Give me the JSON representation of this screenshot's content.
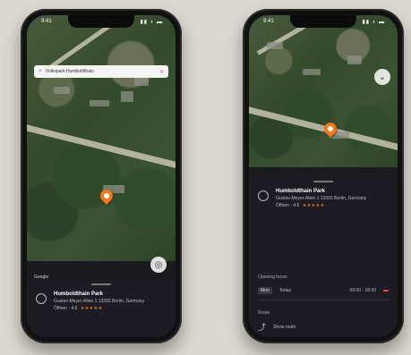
{
  "status": {
    "time": "9:41",
    "icons": "▮▮ ◗ ▬"
  },
  "left_phone": {
    "search_text": "Volkspark Humboldthain",
    "place": {
      "name": "Humboldthain Park",
      "address": "Gustav-Meyer-Allee 1 13355 Berlin, Germany",
      "rating_text": "Öffnen · 4.6",
      "stars": "★★★★★"
    },
    "google_label": "Google"
  },
  "right_phone": {
    "place": {
      "name": "Humboldthain Park",
      "address": "Gustav-Meyer-Allee 1 13355 Berlin, Germany",
      "rating_text": "Öffnen · 4.6",
      "stars": "★★★★★"
    },
    "opening_hours_label": "Opening hours",
    "hours": {
      "chip": "Mon",
      "day": "Today",
      "time": "09:00 - 18:00"
    },
    "route_label": "Route",
    "route_text": "Show route"
  },
  "colors": {
    "accent": "#f07a1a",
    "sheet": "#1d1c24"
  },
  "icons": [
    "search-icon",
    "close-icon",
    "locate-icon",
    "map-pin-icon",
    "place-icon",
    "route-icon",
    "chevron-icon"
  ]
}
